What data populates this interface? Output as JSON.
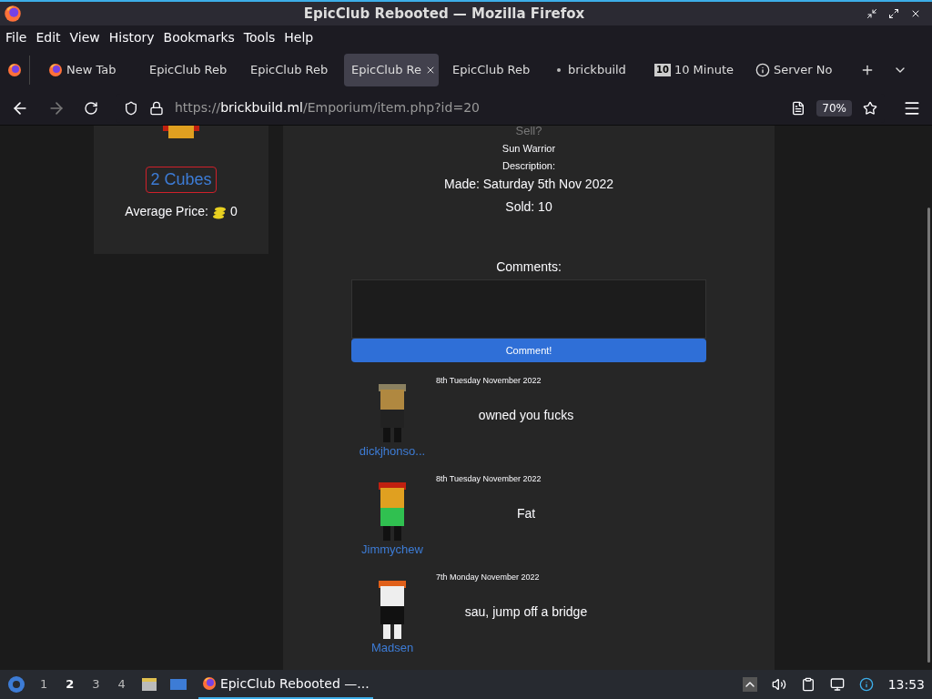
{
  "window": {
    "title": "EpicClub Rebooted — Mozilla Firefox"
  },
  "menu": [
    "File",
    "Edit",
    "View",
    "History",
    "Bookmarks",
    "Tools",
    "Help"
  ],
  "tabs": [
    {
      "label": "New Tab",
      "selected": false,
      "kind": "firefox"
    },
    {
      "label": "EpicClub Reb",
      "selected": false,
      "kind": "plain"
    },
    {
      "label": "EpicClub Reb",
      "selected": false,
      "kind": "plain"
    },
    {
      "label": "EpicClub Re",
      "selected": true,
      "kind": "plain"
    },
    {
      "label": "EpicClub Reb",
      "selected": false,
      "kind": "plain"
    },
    {
      "label": "brickbuild",
      "selected": false,
      "kind": "dot"
    },
    {
      "label": "10 Minute",
      "selected": false,
      "kind": "badge",
      "badge": "10"
    },
    {
      "label": "Server No",
      "selected": false,
      "kind": "info"
    }
  ],
  "address": {
    "scheme": "https://",
    "domain": "brickbuild.ml",
    "path": "/Emporium/item.php?id=20",
    "zoom": "70%"
  },
  "sidebar": {
    "price": "2 Cubes",
    "average_label": "Average Price:",
    "average_value": "0"
  },
  "item": {
    "sell": "Sell?",
    "name": "Sun Warrior",
    "description_label": "Description:",
    "made": "Made: Saturday 5th Nov 2022",
    "sold": "Sold: 10",
    "comments_label": "Comments:",
    "button": "Comment!"
  },
  "comments": [
    {
      "date": "8th Tuesday November 2022",
      "text": "owned you fucks",
      "user": "dickjhonso..."
    },
    {
      "date": "8th Tuesday November 2022",
      "text": "Fat",
      "user": "Jimmychew"
    },
    {
      "date": "7th Monday November 2022",
      "text": "sau, jump off a bridge",
      "user": "Madsen"
    }
  ],
  "taskbar": {
    "workspaces": [
      {
        "label": "1",
        "selected": false
      },
      {
        "label": "2",
        "selected": true
      },
      {
        "label": "3",
        "selected": false
      },
      {
        "label": "4",
        "selected": false
      }
    ],
    "window": "EpicClub Rebooted —...",
    "clock": "13:53"
  }
}
